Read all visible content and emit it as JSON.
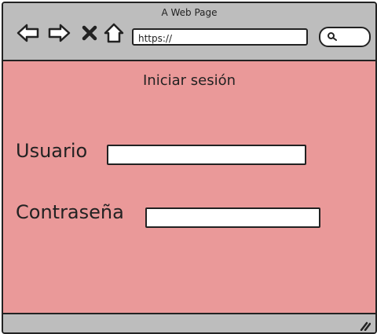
{
  "window": {
    "title": "A Web Page"
  },
  "toolbar": {
    "icons": [
      "back-arrow-icon",
      "forward-arrow-icon",
      "close-icon",
      "home-icon"
    ],
    "address_value": "https://",
    "search_icon": "search-icon"
  },
  "page": {
    "title": "Iniciar sesión",
    "username_label": "Usuario",
    "password_label": "Contraseña",
    "username_value": "",
    "password_value": ""
  },
  "colors": {
    "content_bg": "#ea9999",
    "chrome_bg": "#bdbdbd",
    "ink": "#222222"
  }
}
